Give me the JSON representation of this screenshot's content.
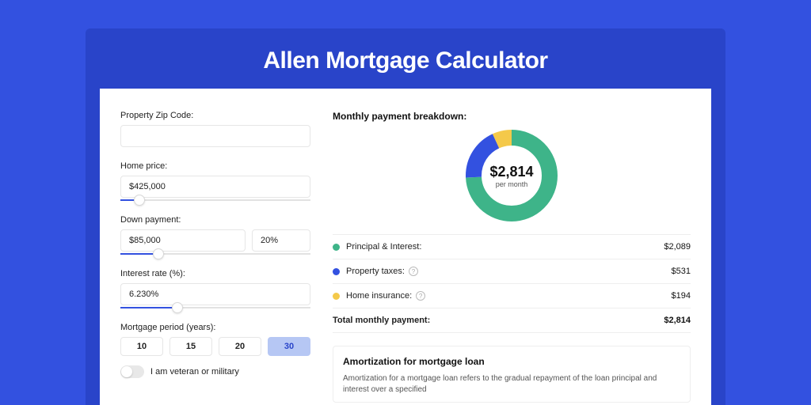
{
  "title": "Allen Mortgage Calculator",
  "form": {
    "zip": {
      "label": "Property Zip Code:",
      "value": ""
    },
    "home_price": {
      "label": "Home price:",
      "value": "$425,000",
      "slider_pct": 10
    },
    "down_payment": {
      "label": "Down payment:",
      "value": "$85,000",
      "pct": "20%",
      "slider_pct": 20
    },
    "interest": {
      "label": "Interest rate (%):",
      "value": "6.230%",
      "slider_pct": 30
    },
    "period": {
      "label": "Mortgage period (years):",
      "options": [
        "10",
        "15",
        "20",
        "30"
      ],
      "selected": "30"
    },
    "veteran": {
      "label": "I am veteran or military",
      "on": false
    }
  },
  "breakdown": {
    "title": "Monthly payment breakdown:",
    "center_value": "$2,814",
    "center_sub": "per month",
    "items": [
      {
        "label": "Principal & Interest:",
        "value": "$2,089",
        "color": "#3eb489",
        "info": false
      },
      {
        "label": "Property taxes:",
        "value": "$531",
        "color": "#3351e0",
        "info": true
      },
      {
        "label": "Home insurance:",
        "value": "$194",
        "color": "#f4c94a",
        "info": true
      }
    ],
    "total_label": "Total monthly payment:",
    "total_value": "$2,814"
  },
  "chart_data": {
    "type": "pie",
    "title": "Monthly payment breakdown",
    "series": [
      {
        "name": "Principal & Interest",
        "value": 2089,
        "color": "#3eb489"
      },
      {
        "name": "Property taxes",
        "value": 531,
        "color": "#3351e0"
      },
      {
        "name": "Home insurance",
        "value": 194,
        "color": "#f4c94a"
      }
    ],
    "total": 2814,
    "center_label": "$2,814 per month"
  },
  "amort": {
    "title": "Amortization for mortgage loan",
    "text": "Amortization for a mortgage loan refers to the gradual repayment of the loan principal and interest over a specified"
  }
}
